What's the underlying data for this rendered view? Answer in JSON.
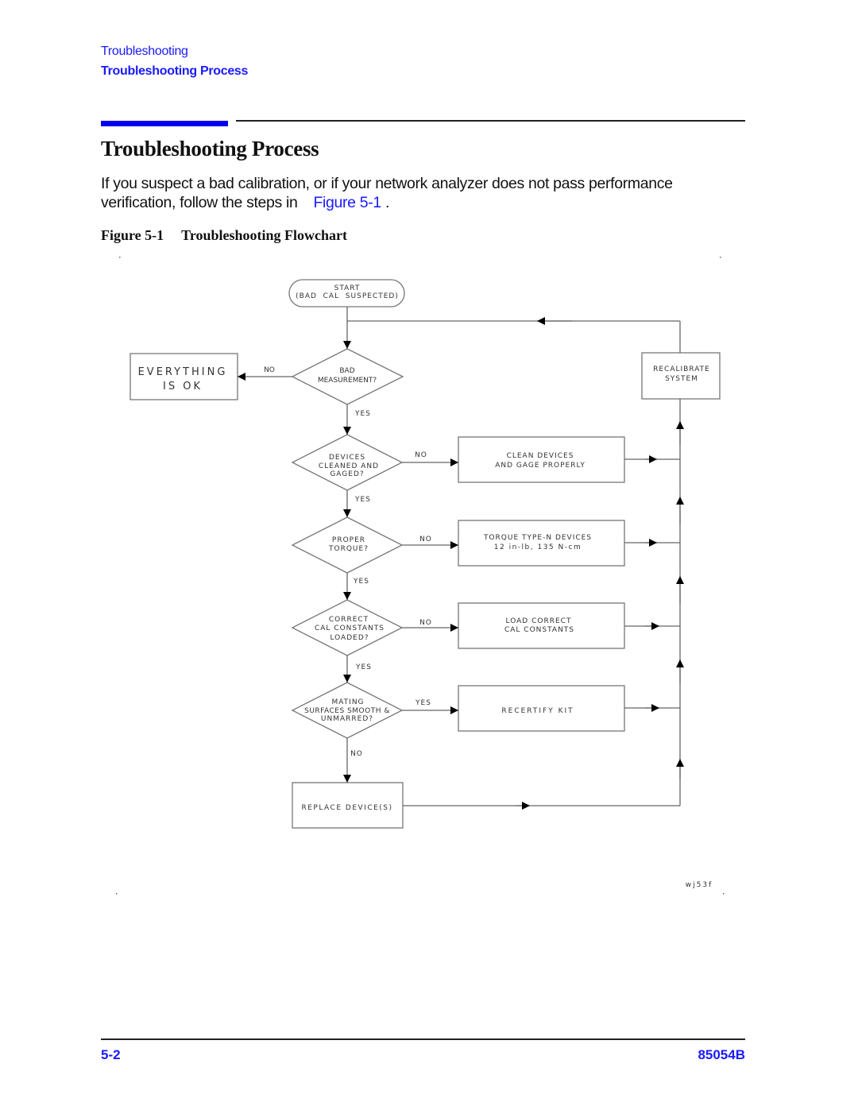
{
  "header": {
    "breadcrumb_chapter": "Troubleshooting",
    "breadcrumb_section": "Troubleshooting Process",
    "accent_color": "#1a1aff"
  },
  "main": {
    "title": "Troubleshooting Process",
    "paragraph_text": "If you suspect a bad calibration, or if your network analyzer does not pass performance verification, follow the steps in",
    "paragraph_link": "Figure 5-1",
    "paragraph_end": ".",
    "figure_number": "Figure 5-1",
    "figure_title": "Troubleshooting Flowchart"
  },
  "flowchart": {
    "start": {
      "line1": "START",
      "line2": "(BAD  CAL  SUSPECTED)"
    },
    "everything_ok": {
      "line1": "EVERYTHING",
      "line2": "IS OK"
    },
    "recalibrate": {
      "line1": "RECALIBRATE",
      "line2": "SYSTEM"
    },
    "decisions": [
      {
        "lines": [
          "BAD",
          "MEASUREMENT?"
        ],
        "side_label": "NO",
        "down_label": "YES"
      },
      {
        "lines": [
          "DEVICES",
          "CLEANED AND",
          "GAGED?"
        ],
        "side_label": "NO",
        "down_label": "YES"
      },
      {
        "lines": [
          "PROPER",
          "TORQUE?"
        ],
        "side_label": "NO",
        "down_label": "YES"
      },
      {
        "lines": [
          "CORRECT",
          "CAL CONSTANTS",
          "LOADED?"
        ],
        "side_label": "NO",
        "down_label": "YES"
      },
      {
        "lines": [
          "MATING",
          "SURFACES SMOOTH &",
          "UNMARRED?"
        ],
        "side_label": "YES",
        "down_label": "NO"
      }
    ],
    "actions": [
      {
        "lines": [
          "CLEAN DEVICES",
          "AND GAGE PROPERLY"
        ]
      },
      {
        "lines": [
          "TORQUE TYPE-N DEVICES",
          "12 in-lb, 135 N-cm"
        ]
      },
      {
        "lines": [
          "LOAD CORRECT",
          "CAL CONSTANTS"
        ]
      },
      {
        "lines": [
          "RECERTIFY KIT"
        ]
      }
    ],
    "replace": {
      "line1": "REPLACE DEVICE(S)"
    },
    "drawing_id": "wj53f"
  },
  "footer": {
    "page_number": "5-2",
    "model": "85054B"
  }
}
